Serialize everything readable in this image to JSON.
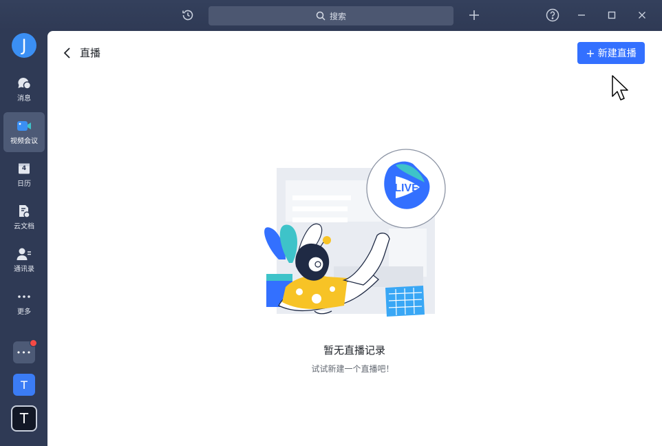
{
  "titlebar": {
    "search_placeholder": "搜索",
    "icons": [
      "history-icon",
      "search-icon",
      "add-icon",
      "help-icon",
      "minimize-icon",
      "maximize-icon",
      "close-icon"
    ]
  },
  "sidebar": {
    "avatar_letter": "J",
    "items": [
      {
        "label": "消息",
        "icon": "message-icon"
      },
      {
        "label": "视频会议",
        "icon": "video-meeting-icon",
        "active": true
      },
      {
        "label": "日历",
        "icon": "calendar-icon",
        "day": "4"
      },
      {
        "label": "云文档",
        "icon": "cloud-doc-icon"
      },
      {
        "label": "通讯录",
        "icon": "contacts-icon"
      },
      {
        "label": "更多",
        "icon": "more-icon"
      }
    ],
    "apps": [
      {
        "label": "•••",
        "badge_color": "#f54a45"
      },
      {
        "label": "T"
      },
      {
        "label": "T"
      }
    ]
  },
  "main": {
    "title": "直播",
    "new_button_label": "新建直播",
    "illustration_badge": "LIVE",
    "empty_title": "暂无直播记录",
    "empty_subtitle": "试试新建一个直播吧！"
  },
  "colors": {
    "accent": "#3370ff",
    "sidebar_bg": "#2f3a55",
    "avatar": "#3b8ff3"
  }
}
